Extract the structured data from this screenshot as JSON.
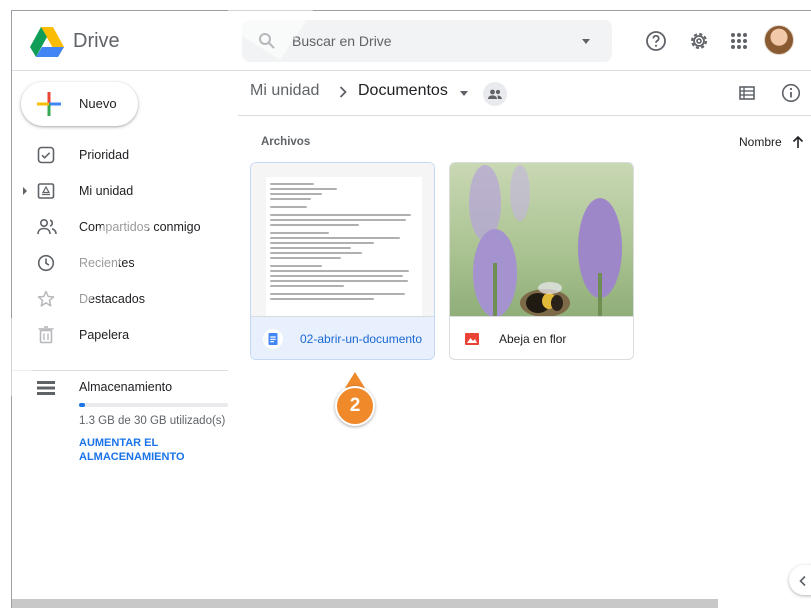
{
  "header": {
    "app_name": "Drive",
    "search_placeholder": "Buscar en Drive"
  },
  "sidebar": {
    "new_label": "Nuevo",
    "items": [
      {
        "label": "Prioridad",
        "icon": "check-square-icon"
      },
      {
        "label": "Mi unidad",
        "icon": "drive-folder-icon"
      },
      {
        "label": "Compartidos conmigo",
        "icon": "people-icon"
      },
      {
        "label": "Recientes",
        "icon": "clock-icon"
      },
      {
        "label": "Destacados",
        "icon": "star-icon"
      },
      {
        "label": "Papelera",
        "icon": "trash-icon"
      }
    ],
    "storage": {
      "title": "Almacenamiento",
      "used_text": "1.3 GB de 30 GB utilizado(s)",
      "used_fraction": 0.043,
      "upgrade_label": "AUMENTAR EL ALMACENAMIENTO"
    }
  },
  "breadcrumb": {
    "root": "Mi unidad",
    "current": "Documentos"
  },
  "files": {
    "section_label": "Archivos",
    "sort_label": "Nombre",
    "items": [
      {
        "name": "02-abrir-un-documento",
        "type": "doc",
        "selected": true
      },
      {
        "name": "Abeja en flor",
        "type": "image",
        "selected": false
      }
    ]
  },
  "callout": {
    "number": "2"
  },
  "colors": {
    "accent": "#1a73e8",
    "callout": "#f0892a",
    "selected_bg": "#e8f0fe"
  }
}
